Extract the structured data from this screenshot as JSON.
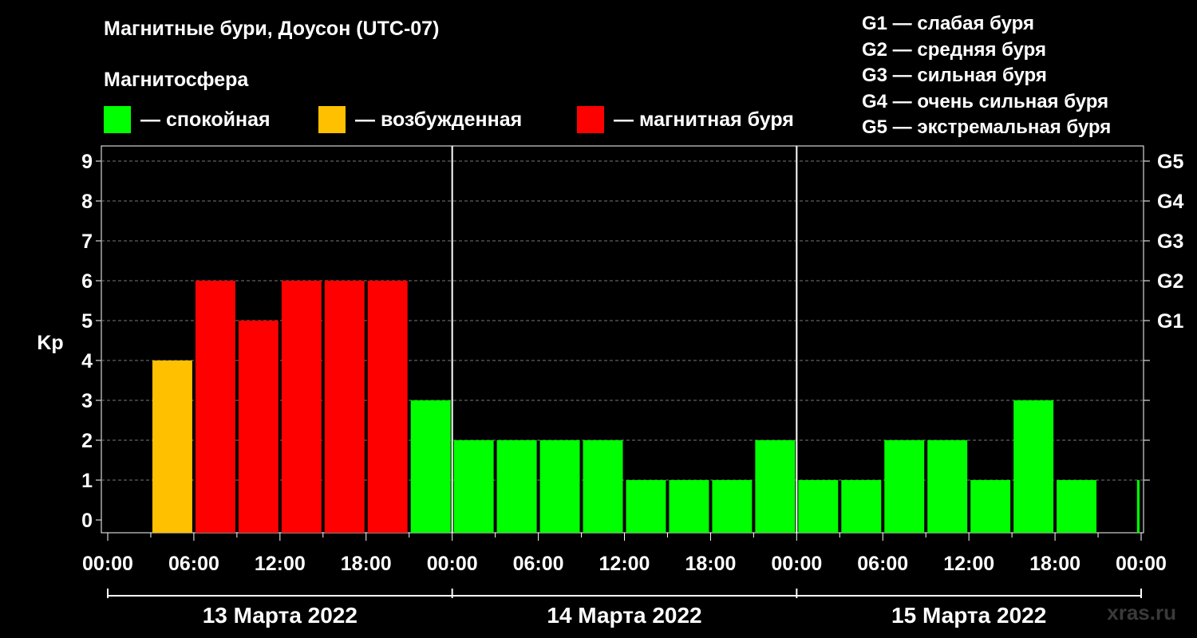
{
  "header": {
    "title": "Магнитные бури, Доусон (UTC-07)",
    "subtitle": "Магнитосфера"
  },
  "legend": {
    "items": [
      {
        "label": "— спокойная",
        "color": "#00ff00"
      },
      {
        "label": "— возбужденная",
        "color": "#ffc000"
      },
      {
        "label": "— магнитная буря",
        "color": "#ff0000"
      }
    ]
  },
  "storm_levels": [
    "G1 — слабая буря",
    "G2 — средняя буря",
    "G3 — сильная буря",
    "G4 — очень сильная буря",
    "G5 — экстремальная буря"
  ],
  "watermark": "xras.ru",
  "colors": {
    "quiet": "#00ff00",
    "active": "#ffc000",
    "storm": "#ff0000"
  },
  "chart_data": {
    "type": "bar",
    "ylabel": "Kp",
    "ylim": [
      0,
      9
    ],
    "y_ticks": [
      "0",
      "1",
      "2",
      "3",
      "4",
      "5",
      "6",
      "7",
      "8",
      "9"
    ],
    "right_ticks": [
      {
        "kp": 5,
        "label": "G1"
      },
      {
        "kp": 6,
        "label": "G2"
      },
      {
        "kp": 7,
        "label": "G3"
      },
      {
        "kp": 8,
        "label": "G4"
      },
      {
        "kp": 9,
        "label": "G5"
      }
    ],
    "x_tick_labels": [
      "00:00",
      "06:00",
      "12:00",
      "18:00",
      "00:00",
      "06:00",
      "12:00",
      "18:00",
      "00:00",
      "06:00",
      "12:00",
      "18:00",
      "00:00"
    ],
    "x_range_hours": [
      0,
      72
    ],
    "bar_width_hours": 3,
    "days": [
      "13 Марта 2022",
      "14 Марта 2022",
      "15 Марта 2022"
    ],
    "grid": "dashed-horizontal",
    "bars": [
      {
        "start_hour": 3,
        "kp": 4,
        "level": "active"
      },
      {
        "start_hour": 6,
        "kp": 6,
        "level": "storm"
      },
      {
        "start_hour": 9,
        "kp": 5,
        "level": "storm"
      },
      {
        "start_hour": 12,
        "kp": 6,
        "level": "storm"
      },
      {
        "start_hour": 15,
        "kp": 6,
        "level": "storm"
      },
      {
        "start_hour": 18,
        "kp": 6,
        "level": "storm"
      },
      {
        "start_hour": 21,
        "kp": 3,
        "level": "quiet"
      },
      {
        "start_hour": 24,
        "kp": 2,
        "level": "quiet"
      },
      {
        "start_hour": 27,
        "kp": 2,
        "level": "quiet"
      },
      {
        "start_hour": 30,
        "kp": 2,
        "level": "quiet"
      },
      {
        "start_hour": 33,
        "kp": 2,
        "level": "quiet"
      },
      {
        "start_hour": 36,
        "kp": 1,
        "level": "quiet"
      },
      {
        "start_hour": 39,
        "kp": 1,
        "level": "quiet"
      },
      {
        "start_hour": 42,
        "kp": 1,
        "level": "quiet"
      },
      {
        "start_hour": 45,
        "kp": 2,
        "level": "quiet"
      },
      {
        "start_hour": 48,
        "kp": 1,
        "level": "quiet"
      },
      {
        "start_hour": 51,
        "kp": 1,
        "level": "quiet"
      },
      {
        "start_hour": 54,
        "kp": 2,
        "level": "quiet"
      },
      {
        "start_hour": 57,
        "kp": 2,
        "level": "quiet"
      },
      {
        "start_hour": 60,
        "kp": 1,
        "level": "quiet"
      },
      {
        "start_hour": 63,
        "kp": 3,
        "level": "quiet"
      },
      {
        "start_hour": 66,
        "kp": 1,
        "level": "quiet"
      },
      {
        "start_hour": 71.6,
        "kp": 1,
        "level": "quiet",
        "width_hours": 0.4
      }
    ]
  }
}
